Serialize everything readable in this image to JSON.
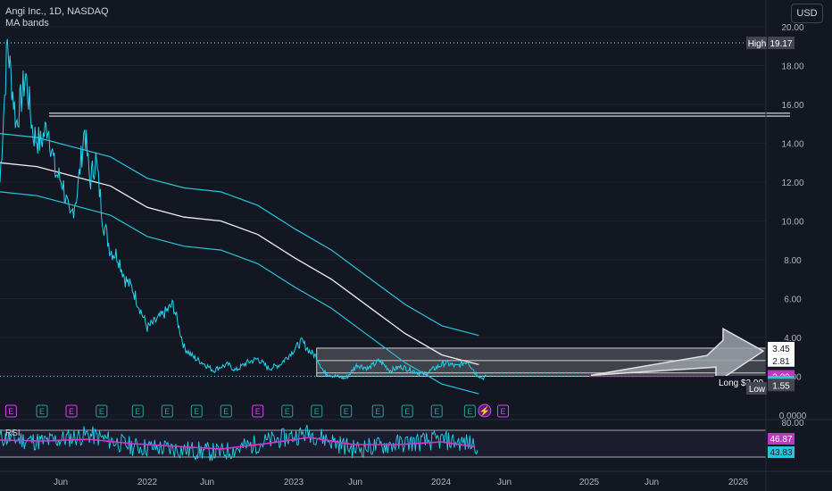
{
  "legend": {
    "symbol": "Angi Inc., 1D, NASDAQ",
    "indicator": "MA bands"
  },
  "currency": "USD",
  "rsi_label": "RSI",
  "colors": {
    "background": "#131722",
    "price_line": "#22d3ee",
    "ma_center": "#f0f0f0",
    "ma_band": "#26c6da",
    "rsi_line": "#22d3ee",
    "rsi_ma": "#d633d6",
    "earnings": "#e040fb",
    "arrow": "#b0b4bc"
  },
  "chart_data": [
    {
      "type": "line",
      "panel": "price",
      "x_ticks": [
        "Jun",
        "2022",
        "Jun",
        "2023",
        "Jun",
        "2024",
        "Jun",
        "2025",
        "Jun",
        "2026"
      ],
      "ylim": [
        0,
        20
      ],
      "y_ticks": [
        "20.00",
        "18.00",
        "16.00",
        "14.00",
        "12.00",
        "10.00",
        "8.00",
        "6.00",
        "4.00",
        "2.00",
        "0.0000"
      ],
      "price_labels": [
        {
          "label": "High",
          "value": "19.17"
        },
        {
          "label": "",
          "value": "3.45"
        },
        {
          "label": "",
          "value": "2.81"
        },
        {
          "label": "",
          "value": "2.17"
        },
        {
          "label": "",
          "value": "2.00"
        },
        {
          "label": "Long $2.00",
          "value": "2.00"
        },
        {
          "label": "Low",
          "value": "1.55"
        }
      ],
      "horizontal_levels": [
        15.4,
        15.55
      ],
      "series": [
        {
          "name": "Price",
          "t": [
            0,
            10,
            22,
            35,
            45,
            55,
            65,
            75,
            85,
            95,
            105,
            115,
            122,
            130,
            140,
            150,
            160,
            170,
            180,
            190,
            200,
            210,
            222,
            235,
            250,
            262,
            275,
            290,
            300,
            310,
            320,
            335,
            350,
            365,
            380,
            395,
            410,
            420,
            430,
            440,
            455,
            470,
            485,
            500,
            515,
            530,
            545,
            560,
            575,
            590,
            605,
            620,
            635,
            645,
            655,
            660
          ],
          "values": [
            12.0,
            19.17,
            15.0,
            17.5,
            14.5,
            14.0,
            15.0,
            12.5,
            12.0,
            10.0,
            11.5,
            14.8,
            12.0,
            13.2,
            10.0,
            8.5,
            8.2,
            7.0,
            6.5,
            5.5,
            4.5,
            4.8,
            5.2,
            5.7,
            3.5,
            3.0,
            2.7,
            2.3,
            2.5,
            2.6,
            2.3,
            2.7,
            2.9,
            2.4,
            2.6,
            3.2,
            3.8,
            3.3,
            3.0,
            2.2,
            2.0,
            1.9,
            2.6,
            2.4,
            2.8,
            2.3,
            2.5,
            2.3,
            2.1,
            2.4,
            2.7,
            2.5,
            2.8,
            2.2,
            1.9,
            2.0
          ]
        },
        {
          "name": "MA",
          "t": [
            0,
            50,
            100,
            150,
            200,
            250,
            300,
            350,
            400,
            450,
            500,
            550,
            600,
            640,
            650
          ],
          "values": [
            13.0,
            12.8,
            12.3,
            11.8,
            10.7,
            10.2,
            10.0,
            9.3,
            8.1,
            7.0,
            5.6,
            4.2,
            3.1,
            2.7,
            2.6
          ]
        }
      ],
      "ma_band_offset": 1.5,
      "earnings_markers": [
        "E",
        "E",
        "E",
        "E",
        "E",
        "E",
        "E",
        "E",
        "E",
        "E",
        "E",
        "E",
        "E",
        "E",
        "E",
        "E",
        "E"
      ],
      "projection": {
        "label": "Long $2.00",
        "entry": 2.0,
        "target": 3.45,
        "stop": 1.55
      }
    },
    {
      "type": "line",
      "panel": "rsi",
      "ylim": [
        0,
        80
      ],
      "y_ticks": [
        "80.00"
      ],
      "values_shown": {
        "rsi": "46.87",
        "rsi_ma": "43.83"
      },
      "series": [
        {
          "name": "RSI",
          "t": [
            0,
            60,
            120,
            180,
            240,
            300,
            360,
            420,
            480,
            540,
            600,
            650
          ],
          "values": [
            55,
            50,
            58,
            45,
            42,
            38,
            50,
            60,
            42,
            48,
            52,
            46.87
          ]
        },
        {
          "name": "RSI MA",
          "t": [
            0,
            60,
            120,
            180,
            240,
            300,
            360,
            420,
            480,
            540,
            600,
            650
          ],
          "values": [
            52,
            51,
            53,
            48,
            45,
            42,
            48,
            55,
            47,
            47,
            50,
            43.83
          ]
        }
      ]
    }
  ]
}
